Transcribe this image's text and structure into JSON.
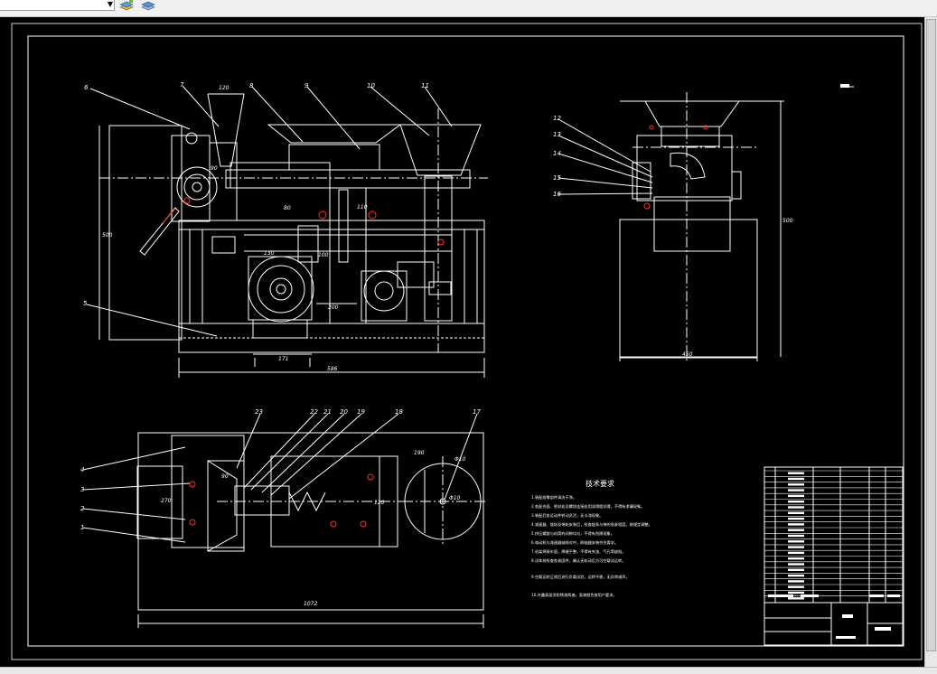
{
  "toolbar": {
    "layer_value": "",
    "icons": [
      "layer-states-icon",
      "layer-manager-icon"
    ]
  },
  "drawing": {
    "colors": {
      "background": "#000000",
      "line": "#ffffff",
      "accent": "#ff3030"
    },
    "balloons_front": [
      "6",
      "7",
      "8",
      "9",
      "10",
      "11",
      "5"
    ],
    "balloons_side": [
      "12",
      "13",
      "14",
      "15",
      "16"
    ],
    "balloons_plan": [
      "23",
      "22",
      "21",
      "20",
      "19",
      "18",
      "17",
      "4",
      "3",
      "2",
      "1"
    ],
    "dims_front": [
      "120",
      "90",
      "80",
      "110",
      "500",
      "100",
      "130",
      "200",
      "171",
      "586"
    ],
    "dims_side": [
      "450",
      "500"
    ],
    "dims_plan": [
      "1072",
      "270",
      "90",
      "190",
      "120",
      "Φ10",
      "Φ10"
    ],
    "notes_title": "技术要求",
    "notes_lines": [
      "1.装配前零部件清洗干净。",
      "2.各配合面、密封处及螺纹连接处用润滑脂润滑，不得有渗漏现象。",
      "3.装配后各运动件转动灵活，无卡滞现象。",
      "4.减速器、链轮及带轮安装后，检查链条与带的张紧程度，按规定调整。",
      "5.挤压螺旋与机筒的间隙均匀，不得有刮擦现象。",
      "6.电动机与减速器轴线对中，联轴器安装符合要求。",
      "7.机架焊接牢固，焊缝平整，不得有夹渣、气孔等缺陷。",
      "8.试车前检查各紧固件，确认无松动后方可空载试运转。",
      "9.空载运转正常后进行负载试验，运转平稳，无异常噪声。",
      "10.外露表面涂防锈漆两遍，面漆颜色按用户要求。"
    ]
  }
}
